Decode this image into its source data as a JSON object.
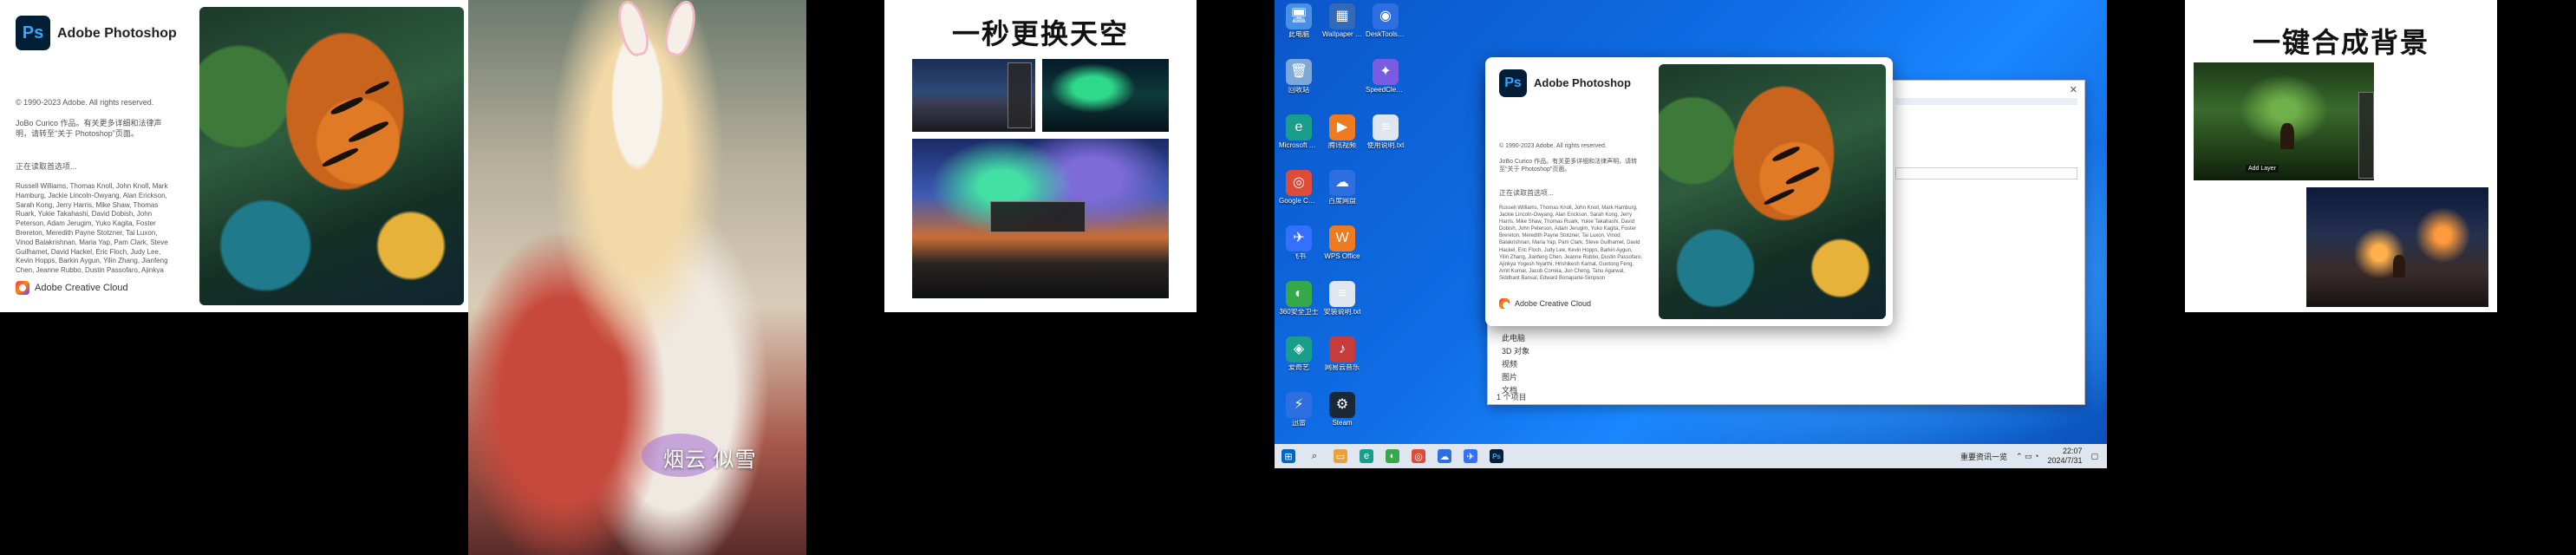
{
  "splash": {
    "app_name": "Adobe Photoshop",
    "ps_letters": "Ps",
    "copyright": "© 1990-2023 Adobe. All rights reserved.",
    "artwork_credit": "JoBo Curico 作品。有关更多详细和法律声明，请转至\"关于 Photoshop\"页面。",
    "loading": "正在读取首选项...",
    "credits": "Russell Williams, Thomas Knoll, John Knoll, Mark Hamburg, Jackie Lincoln-Owyang, Alan Erickson, Sarah Kong, Jerry Harris, Mike Shaw, Thomas Ruark, Yukie Takahashi, David Dobish, John Peterson, Adam Jerugim, Yuko Kagita, Foster Brereton, Meredith Payne Stotzner, Tai Luxon, Vinod Balakrishnan, Maria Yap, Pam Clark, Steve Guilhamet, David Hackel, Eric Floch, Judy Lee, Kevin Hopps, Barkin Aygun, Yilin Zhang, Jianfeng Chen, Jeanne Rubbo, Dustin Passofaro, Ajinkya Yogesh Nyarthi, Hrishikesh Kamat, Guotong Feng, Amit Kumar, Jacob Correia, Jun Cheng, Tanu Agarwal, Siddhant Bansal, Edward Bonaparte-Simpson",
    "cloud": "Adobe Creative Cloud"
  },
  "girl_panel": {
    "caption": "烟云  似雪"
  },
  "sky_panel": {
    "title": "一秒更换天空"
  },
  "desktop": {
    "icons": [
      {
        "label": "此电脑",
        "glyph": "computer-icon",
        "color": "#4a90e2",
        "sym": "🖥"
      },
      {
        "label": "Wallpaper Engine",
        "glyph": "wallpaper-icon",
        "color": "#3468b8",
        "sym": "▦"
      },
      {
        "label": "DeskTools Helper",
        "glyph": "helper-icon",
        "color": "#2d6ee0",
        "sym": "◉"
      },
      {
        "label": "回收站",
        "glyph": "recycle-bin-icon",
        "color": "#7fa8d8",
        "sym": "🗑"
      },
      {
        "label": "",
        "glyph": "empty",
        "color": "transparent",
        "sym": ""
      },
      {
        "label": "SpeedCleaner",
        "glyph": "cleaner-icon",
        "color": "#7a5ce0",
        "sym": "✦"
      },
      {
        "label": "Microsoft Edge",
        "glyph": "edge-icon",
        "color": "#1a9e8c",
        "sym": "e"
      },
      {
        "label": "腾讯视频",
        "glyph": "video-icon",
        "color": "#f07a1e",
        "sym": "▶"
      },
      {
        "label": "使用说明.txt",
        "glyph": "text-file-icon",
        "color": "#dfe6ef",
        "sym": "≡"
      },
      {
        "label": "Google Chrome",
        "glyph": "chrome-icon",
        "color": "#de4b39",
        "sym": "◎"
      },
      {
        "label": "百度网盘",
        "glyph": "netdisk-icon",
        "color": "#2d6ee0",
        "sym": "☁"
      },
      {
        "label": "",
        "glyph": "empty",
        "color": "transparent",
        "sym": ""
      },
      {
        "label": "飞书",
        "glyph": "feishu-icon",
        "color": "#3370ff",
        "sym": "✈"
      },
      {
        "label": "WPS Office",
        "glyph": "wps-icon",
        "color": "#f07a1e",
        "sym": "W"
      },
      {
        "label": "",
        "glyph": "empty",
        "color": "transparent",
        "sym": ""
      },
      {
        "label": "360安全卫士",
        "glyph": "security-icon",
        "color": "#35a84a",
        "sym": "◐"
      },
      {
        "label": "安装说明.txt",
        "glyph": "text-file-icon",
        "color": "#dfe6ef",
        "sym": "≡"
      },
      {
        "label": "",
        "glyph": "empty",
        "color": "transparent",
        "sym": ""
      },
      {
        "label": "爱奇艺",
        "glyph": "player-icon",
        "color": "#1a9e8c",
        "sym": "◈"
      },
      {
        "label": "网易云音乐",
        "glyph": "music-icon",
        "color": "#c83b3b",
        "sym": "♪"
      },
      {
        "label": "",
        "glyph": "empty",
        "color": "transparent",
        "sym": ""
      },
      {
        "label": "迅雷",
        "glyph": "thunder-icon",
        "color": "#2d6ee0",
        "sym": "⚡"
      },
      {
        "label": "Steam",
        "glyph": "steam-icon",
        "color": "#1b2838",
        "sym": "⚙"
      }
    ],
    "explorer_nav": [
      "此电脑",
      "3D 对象",
      "视频",
      "图片",
      "文档"
    ],
    "explorer_status": "1 个项目",
    "taskbar_notify": "重要资讯一览",
    "clock_time": "22:07",
    "clock_date": "2024/7/31"
  },
  "composite_panel": {
    "title": "一键合成背景",
    "deer_hint": "Add Layer"
  },
  "colors": {
    "ps_blue": "#31a8ff",
    "ps_bg": "#001e36",
    "win_blue": "#0f6ee6"
  }
}
